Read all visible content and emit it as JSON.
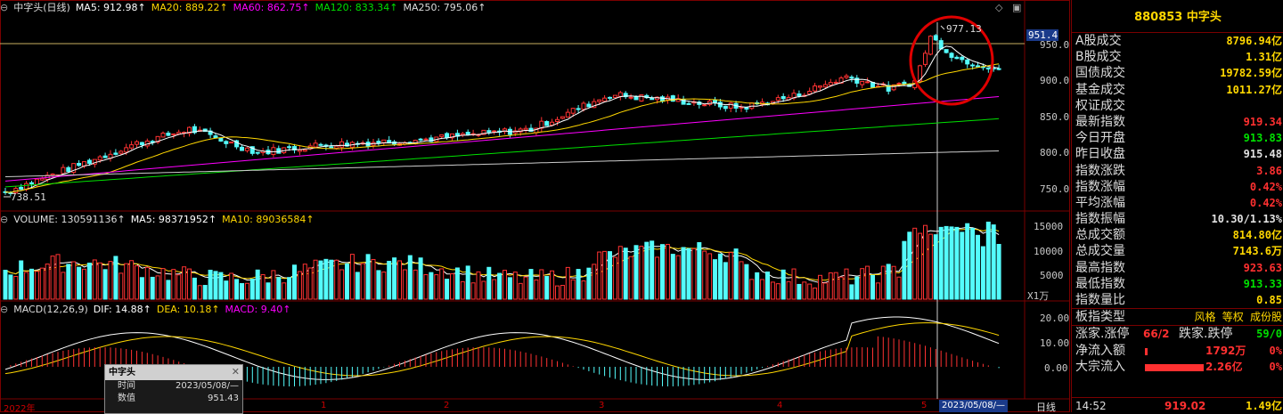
{
  "price_legend": {
    "name": "中字头(日线)",
    "ma5": "MA5: 912.98↑",
    "ma20": "MA20: 889.22↑",
    "ma60": "MA60: 862.75↑",
    "ma120": "MA120: 833.34↑",
    "ma250": "MA250: 795.06↑"
  },
  "price_axis": [
    "950.0",
    "900.0",
    "850.0",
    "800.0",
    "750.0"
  ],
  "price_marker": "951.4",
  "high_label": "977.13",
  "low_label": "738.51",
  "volume_legend": {
    "volume": "VOLUME: 130591136↑",
    "ma5": "MA5: 98371952↑",
    "ma10": "MA10: 89036584↑"
  },
  "volume_axis": [
    "15000",
    "10000",
    "5000"
  ],
  "volume_unit": "X1万",
  "macd_legend": {
    "title": "MACD(12,26,9)",
    "dif": "DIF: 14.88↑",
    "dea": "DEA: 10.18↑",
    "macd": "MACD: 9.40↑"
  },
  "macd_axis": [
    "20.00",
    "10.00",
    "0.00"
  ],
  "popup": {
    "title": "中字头",
    "time_label": "时间",
    "time_value": "2023/05/08/—",
    "value_label": "数值",
    "value_value": "951.43"
  },
  "date_axis": {
    "start": "2022年",
    "months": [
      "1",
      "2",
      "3",
      "4",
      "5"
    ],
    "cursor": "2023/05/08/—",
    "period": "日线"
  },
  "right_panel": {
    "code": "880853",
    "name": "中字头",
    "rows": [
      {
        "label": "A股成交",
        "value": "8796.94亿",
        "color": "#ffd700"
      },
      {
        "label": "B股成交",
        "value": "1.31亿",
        "color": "#ffd700"
      },
      {
        "label": "国债成交",
        "value": "19782.59亿",
        "color": "#ffd700"
      },
      {
        "label": "基金成交",
        "value": "1011.27亿",
        "color": "#ffd700"
      },
      {
        "label": "权证成交",
        "value": "",
        "color": "#ffd700"
      },
      {
        "label": "最新指数",
        "value": "919.34",
        "color": "#ff3030"
      },
      {
        "label": "今日开盘",
        "value": "913.83",
        "color": "#00e000"
      },
      {
        "label": "昨日收盘",
        "value": "915.48",
        "color": "#e0e0e0"
      },
      {
        "label": "指数涨跌",
        "value": "3.86",
        "color": "#ff3030"
      },
      {
        "label": "指数涨幅",
        "value": "0.42%",
        "color": "#ff3030"
      },
      {
        "label": "平均涨幅",
        "value": "0.42%",
        "color": "#ff3030"
      },
      {
        "label": "指数振幅",
        "value": "10.30/1.13%",
        "color": "#e0e0e0"
      },
      {
        "label": "总成交额",
        "value": "814.80亿",
        "color": "#ffd700"
      },
      {
        "label": "总成交量",
        "value": "7143.6万",
        "color": "#ffd700"
      },
      {
        "label": "最高指数",
        "value": "923.63",
        "color": "#ff3030"
      },
      {
        "label": "最低指数",
        "value": "913.33",
        "color": "#00e000"
      },
      {
        "label": "指数量比",
        "value": "0.85",
        "color": "#ffd700"
      }
    ],
    "sector": {
      "label": "板指类型",
      "tags": "风格 等权 成份股"
    },
    "updown": {
      "up_label": "涨家.涨停",
      "up_value": "66/2",
      "down_label": "跌家.跌停",
      "down_value": "59/0"
    },
    "flow1": {
      "label": "净流入额",
      "value": "1792万",
      "pct": "0%"
    },
    "flow2": {
      "label": "大宗流入",
      "value": "2.26亿",
      "pct": "0%"
    },
    "footer": {
      "time": "14:52",
      "price": "919.02",
      "vol": "1.49亿"
    }
  },
  "colors": {
    "up": "#ff3232",
    "down": "#54fcfc",
    "ma5": "#ffffff",
    "ma20": "#ffd700",
    "ma60": "#ff00ff",
    "ma120": "#00e000",
    "ma250": "#cccccc",
    "grid": "#7a0000"
  }
}
